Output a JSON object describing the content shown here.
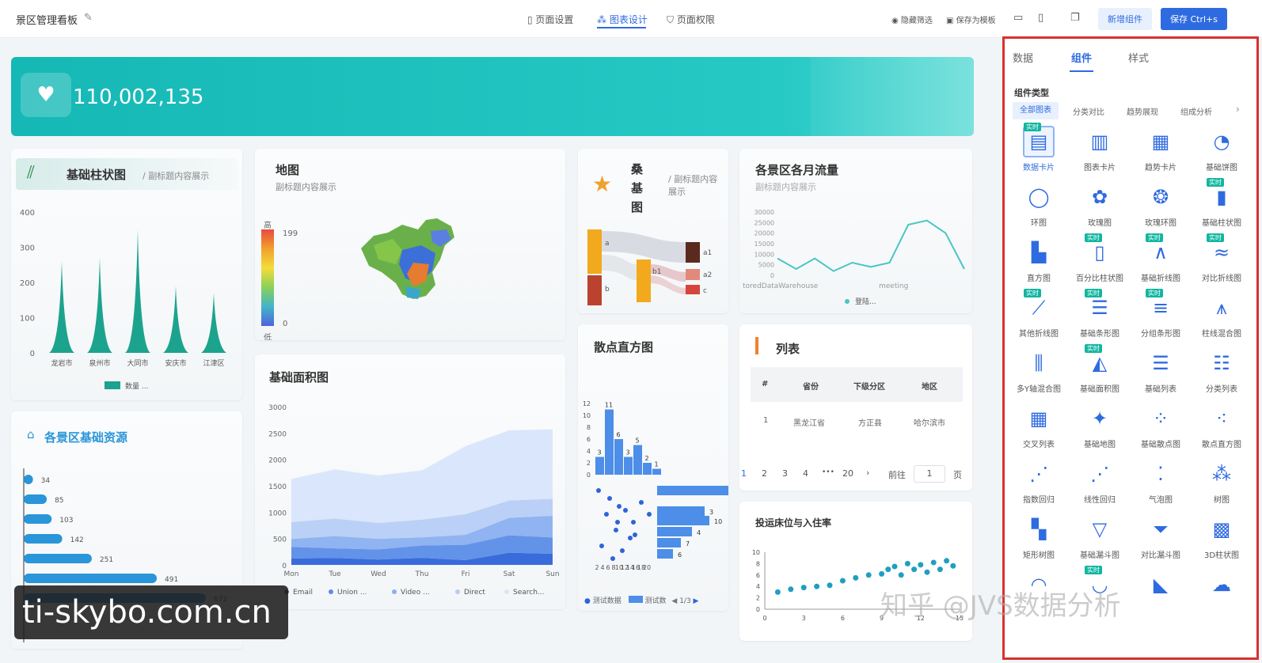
{
  "header": {
    "title": "景区管理看板",
    "tabs": [
      {
        "label": "页面设置"
      },
      {
        "label": "图表设计"
      },
      {
        "label": "页面权限"
      }
    ],
    "actions": {
      "hide_filter": "隐藏筛选",
      "save_template": "保存为模板",
      "add_component": "新增组件",
      "save": "保存 Ctrl+s"
    }
  },
  "banner": {
    "value": "110,002,135"
  },
  "bar_card": {
    "title": "基础柱状图",
    "subtitle": "/ 副标题内容展示",
    "legend": "数量 ..."
  },
  "map_card": {
    "title": "地图",
    "subtitle": "副标题内容展示",
    "scale_high": "高",
    "scale_low": "低",
    "max": "199",
    "min": "0"
  },
  "sankey_card": {
    "title": "桑基图",
    "subtitle": "/ 副标题内容展示",
    "labels": [
      "a",
      "b",
      "b1",
      "a1",
      "a2",
      "c"
    ]
  },
  "flow_card": {
    "title": "各景区各月流量",
    "subtitle": "副标题内容展示",
    "legend": "登陆..."
  },
  "resource_card": {
    "title": "各景区基础资源"
  },
  "area_card": {
    "title": "基础面积图"
  },
  "scatter_hist_card": {
    "title": "散点直方图",
    "legend": [
      "测试数据",
      "测试数"
    ],
    "pager": "1/3"
  },
  "list_card": {
    "title": "列表",
    "columns": [
      "#",
      "省份",
      "下级分区",
      "地区"
    ],
    "rows": [
      [
        "1",
        "黑龙江省",
        "方正县",
        "哈尔滨市"
      ]
    ],
    "pager": {
      "pages": [
        "1",
        "2",
        "3",
        "4",
        "•••",
        "20"
      ],
      "goto": "前往",
      "page_input": "1",
      "page_unit": "页"
    }
  },
  "occupancy_card": {
    "title": "投运床位与入住率"
  },
  "watermark": {
    "site": "ti-skybo.com.cn",
    "zhihu": "知乎 @JVS数据分析"
  },
  "panel": {
    "tabs": [
      "数据",
      "组件",
      "样式"
    ],
    "section_title": "组件类型",
    "filters": [
      "全部图表",
      "分类对比",
      "趋势展现",
      "组成分析"
    ],
    "badge": "实时",
    "items": [
      {
        "label": "数据卡片",
        "icon": "data-card-icon",
        "badge": true,
        "selected": true
      },
      {
        "label": "图表卡片",
        "icon": "chart-card-icon"
      },
      {
        "label": "趋势卡片",
        "icon": "trend-card-icon"
      },
      {
        "label": "基础饼图",
        "icon": "pie-icon"
      },
      {
        "label": "环图",
        "icon": "ring-icon"
      },
      {
        "label": "玫瑰图",
        "icon": "rose-icon"
      },
      {
        "label": "玫瑰环图",
        "icon": "rose-ring-icon"
      },
      {
        "label": "基础柱状图",
        "icon": "bar-icon",
        "badge": true
      },
      {
        "label": "直方图",
        "icon": "histogram-icon"
      },
      {
        "label": "百分比柱状图",
        "icon": "percent-bar-icon",
        "badge": true
      },
      {
        "label": "基础折线图",
        "icon": "line-icon",
        "badge": true
      },
      {
        "label": "对比折线图",
        "icon": "compare-line-icon",
        "badge": true
      },
      {
        "label": "其他折线图",
        "icon": "other-line-icon",
        "badge": true
      },
      {
        "label": "基础条形图",
        "icon": "hbar-icon",
        "badge": true
      },
      {
        "label": "分组条形图",
        "icon": "group-hbar-icon",
        "badge": true
      },
      {
        "label": "柱线混合图",
        "icon": "bar-line-icon"
      },
      {
        "label": "多Y轴混合图",
        "icon": "multi-y-icon"
      },
      {
        "label": "基础面积图",
        "icon": "area-icon",
        "badge": true
      },
      {
        "label": "基础列表",
        "icon": "list-icon"
      },
      {
        "label": "分类列表",
        "icon": "category-list-icon"
      },
      {
        "label": "交叉列表",
        "icon": "cross-list-icon"
      },
      {
        "label": "基础地图",
        "icon": "map-icon"
      },
      {
        "label": "基础散点图",
        "icon": "scatter-icon"
      },
      {
        "label": "散点直方图",
        "icon": "scatter-hist-icon"
      },
      {
        "label": "指数回归",
        "icon": "exp-regression-icon"
      },
      {
        "label": "线性回归",
        "icon": "linear-regression-icon"
      },
      {
        "label": "气泡图",
        "icon": "bubble-icon"
      },
      {
        "label": "树图",
        "icon": "tree-icon"
      },
      {
        "label": "矩形树图",
        "icon": "treemap-icon"
      },
      {
        "label": "基础漏斗图",
        "icon": "funnel-icon"
      },
      {
        "label": "对比漏斗图",
        "icon": "compare-funnel-icon"
      },
      {
        "label": "3D柱状图",
        "icon": "bar3d-icon"
      },
      {
        "label": "",
        "icon": "gauge-icon"
      },
      {
        "label": "",
        "icon": "gauge2-icon",
        "badge": true
      },
      {
        "label": "",
        "icon": "ribbon-icon"
      },
      {
        "label": "",
        "icon": "wordcloud-icon"
      }
    ]
  },
  "chart_data": [
    {
      "type": "bar",
      "title": "基础柱状图",
      "categories": [
        "龙岩市",
        "泉州市",
        "大同市",
        "安庆市",
        "江津区"
      ],
      "series": [
        {
          "name": "数量",
          "values": [
            260,
            270,
            350,
            190,
            170
          ]
        }
      ],
      "ylim": [
        0,
        400
      ],
      "yticks": [
        0,
        100,
        200,
        300,
        400
      ],
      "color": "#1ca38d"
    },
    {
      "type": "bar",
      "title": "各景区基础资源",
      "orientation": "horizontal",
      "values": [
        34,
        85,
        103,
        142,
        251,
        491,
        672
      ],
      "color": "#2a95d8"
    },
    {
      "type": "area",
      "title": "基础面积图",
      "categories": [
        "Mon",
        "Tue",
        "Wed",
        "Thu",
        "Fri",
        "Sat",
        "Sun"
      ],
      "series": [
        {
          "name": "Email",
          "values": [
            120,
            132,
            101,
            134,
            90,
            230,
            210
          ]
        },
        {
          "name": "Union ...",
          "values": [
            220,
            182,
            191,
            234,
            290,
            330,
            310
          ]
        },
        {
          "name": "Video ...",
          "values": [
            150,
            232,
            201,
            154,
            190,
            330,
            410
          ]
        },
        {
          "name": "Direct",
          "values": [
            320,
            332,
            301,
            334,
            390,
            330,
            320
          ]
        },
        {
          "name": "Search...",
          "values": [
            820,
            932,
            901,
            934,
            1290,
            1330,
            1320
          ]
        }
      ],
      "stacked": true,
      "ylim": [
        0,
        3000
      ],
      "yticks": [
        0,
        500,
        1000,
        1500,
        2000,
        2500,
        3000
      ],
      "colors": [
        "#2f63d8",
        "#5b8de8",
        "#8aaff0",
        "#b6cdf6",
        "#d8e5fb"
      ]
    },
    {
      "type": "line",
      "title": "各景区各月流量",
      "categories": [
        "toredDataWarehouse",
        "meeting"
      ],
      "yticks": [
        0,
        5000,
        10000,
        15000,
        20000,
        25000,
        30000
      ],
      "ylim": [
        0,
        30000
      ],
      "series": [
        {
          "name": "登陆...",
          "values": [
            8000,
            3000,
            8000,
            2000,
            6000,
            4000,
            6000,
            24000,
            26000,
            20000,
            3000
          ]
        }
      ],
      "color": "#49c6c4"
    },
    {
      "type": "bar",
      "title": "散点直方图",
      "categories": [
        "2",
        "4",
        "6",
        "8",
        "10",
        "12",
        "14",
        "16",
        "18",
        "20"
      ],
      "values": [
        3,
        11,
        6,
        3,
        5,
        2,
        1
      ],
      "yticks": [
        0,
        2,
        4,
        6,
        8,
        10,
        12
      ],
      "color": "#4d8ee8"
    },
    {
      "type": "scatter",
      "title": "投运床位与入住率",
      "x": [
        1,
        2,
        3,
        4,
        5,
        6,
        7,
        8,
        9,
        9.5,
        10,
        10.5,
        11,
        11.5,
        12,
        12.5,
        13,
        13.5,
        14,
        14.5
      ],
      "y": [
        3,
        3.5,
        3.8,
        4,
        4.2,
        5,
        5.5,
        6,
        6.2,
        7,
        7.5,
        6,
        8,
        7,
        7.8,
        6.5,
        8.2,
        7,
        8.5,
        7.6
      ],
      "xticks": [
        0,
        3,
        6,
        9,
        12,
        15
      ],
      "yticks": [
        0,
        2,
        4,
        6,
        8,
        10
      ],
      "xlim": [
        0,
        15
      ],
      "ylim": [
        0,
        10
      ],
      "color": "#1f9fc0"
    }
  ]
}
